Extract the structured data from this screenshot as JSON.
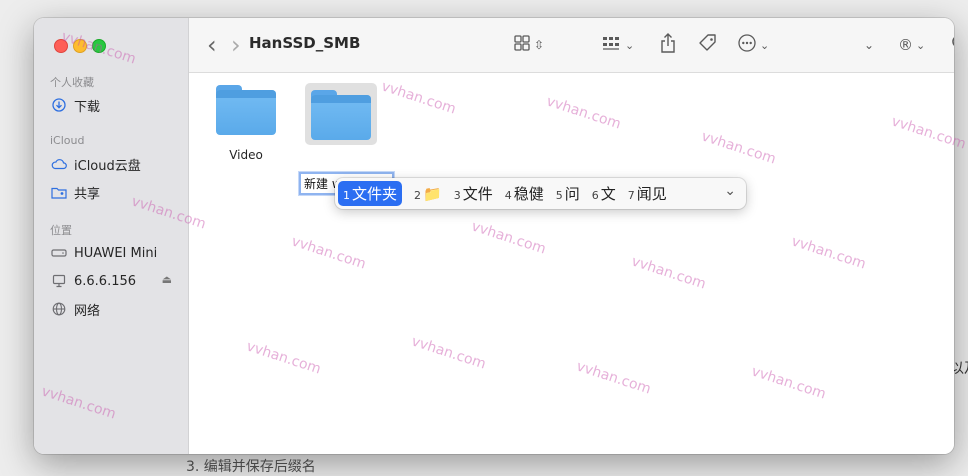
{
  "background": {
    "text_right": "以及",
    "text_bottom": "3. 编辑并保存后缀名"
  },
  "window": {
    "title": "HanSSD_SMB"
  },
  "sidebar": {
    "favorites": {
      "header": "个人收藏",
      "items": [
        {
          "label": "下载",
          "icon": "download-icon"
        }
      ]
    },
    "icloud": {
      "header": "iCloud",
      "items": [
        {
          "label": "iCloud云盘",
          "icon": "cloud-icon"
        },
        {
          "label": "共享",
          "icon": "shared-folder-icon"
        }
      ]
    },
    "locations": {
      "header": "位置",
      "items": [
        {
          "label": "HUAWEI Mini",
          "icon": "drive-icon"
        },
        {
          "label": "6.6.6.156",
          "icon": "display-icon"
        },
        {
          "label": "网络",
          "icon": "globe-icon"
        }
      ]
    }
  },
  "toolbar": {
    "back": "‹",
    "forward": "›",
    "icons": [
      "grid-view-icon",
      "group-icon",
      "share-icon",
      "tag-icon",
      "more-icon",
      "search-icon"
    ],
    "chevron": "⌄",
    "registered": "®"
  },
  "files": [
    {
      "name": "Video"
    },
    {
      "name": "新建 wen jian j",
      "editing": true
    }
  ],
  "ime": {
    "candidates": [
      {
        "num": "1",
        "text": "文件夹",
        "selected": true
      },
      {
        "num": "2",
        "text": "📁"
      },
      {
        "num": "3",
        "text": "文件"
      },
      {
        "num": "4",
        "text": "稳健"
      },
      {
        "num": "5",
        "text": "问"
      },
      {
        "num": "6",
        "text": "文"
      },
      {
        "num": "7",
        "text": "闻见"
      }
    ],
    "expand": "⌄"
  },
  "watermark": "vvhan.com",
  "colors": {
    "accent": "#2b6ef2",
    "folder": "#5aaaea",
    "sidebar_bg": "#e3e3e6",
    "watermark": "#c850aa"
  }
}
